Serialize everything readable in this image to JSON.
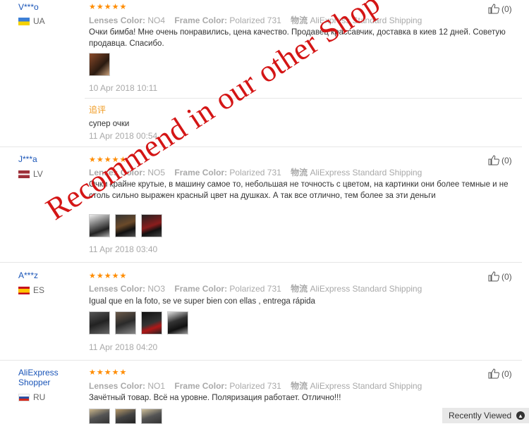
{
  "reviews": [
    {
      "user": "V***o",
      "country": "UA",
      "stars": "★★★★★",
      "lenses_label": "Lenses Color:",
      "lenses": "NO4",
      "frame_label": "Frame Color:",
      "frame": "Polarized 731",
      "shipping_label": "物流",
      "shipping": "AliExpress Standard Shipping",
      "text": "Очки бимба!  Мне очень понравились, цена качество. Продавец крассавчик, доставка в киев 12 дней. Советую продавца. Спасибо.",
      "date": "10 Apr 2018 10:11",
      "additional_label": "追评",
      "additional_text": "супер очки",
      "additional_date": "11 Apr 2018 00:54",
      "helpful": "(0)"
    },
    {
      "user": "J***a",
      "country": "LV",
      "stars": "★★★★★",
      "lenses_label": "Lenses Color:",
      "lenses": "NO5",
      "frame_label": "Frame Color:",
      "frame": "Polarized 731",
      "shipping_label": "物流",
      "shipping": "AliExpress Standard Shipping",
      "text": "Очки крайне крутые, в машину самое то, небольшая не точность с цветом, на картинки они более темные и не столь сильно выражен красный цвет на душках. А так все отлично, тем более за эти деньги",
      "date": "11 Apr 2018 03:40",
      "helpful": "(0)"
    },
    {
      "user": "A***z",
      "country": "ES",
      "stars": "★★★★★",
      "lenses_label": "Lenses Color:",
      "lenses": "NO3",
      "frame_label": "Frame Color:",
      "frame": "Polarized 731",
      "shipping_label": "物流",
      "shipping": "AliExpress Standard Shipping",
      "text": "Igual que en la foto, se ve super bien con ellas , entrega rápida",
      "date": "11 Apr 2018 04:20",
      "helpful": "(0)"
    },
    {
      "user": "AliExpress Shopper",
      "country": "RU",
      "stars": "★★★★★",
      "lenses_label": "Lenses Color:",
      "lenses": "NO1",
      "frame_label": "Frame Color:",
      "frame": "Polarized 731",
      "shipping_label": "物流",
      "shipping": "AliExpress Standard Shipping",
      "text": "Зачётный товар. Всё на уровне. Поляризация работает. Отлично!!!",
      "helpful": "(0)"
    }
  ],
  "watermark": "Recommend in our other Shop",
  "recently_viewed": "Recently Viewed",
  "colors": {
    "star": "#ff8c00",
    "username": "#1a55b8",
    "watermark": "#d41515",
    "additional": "#f09b21"
  }
}
